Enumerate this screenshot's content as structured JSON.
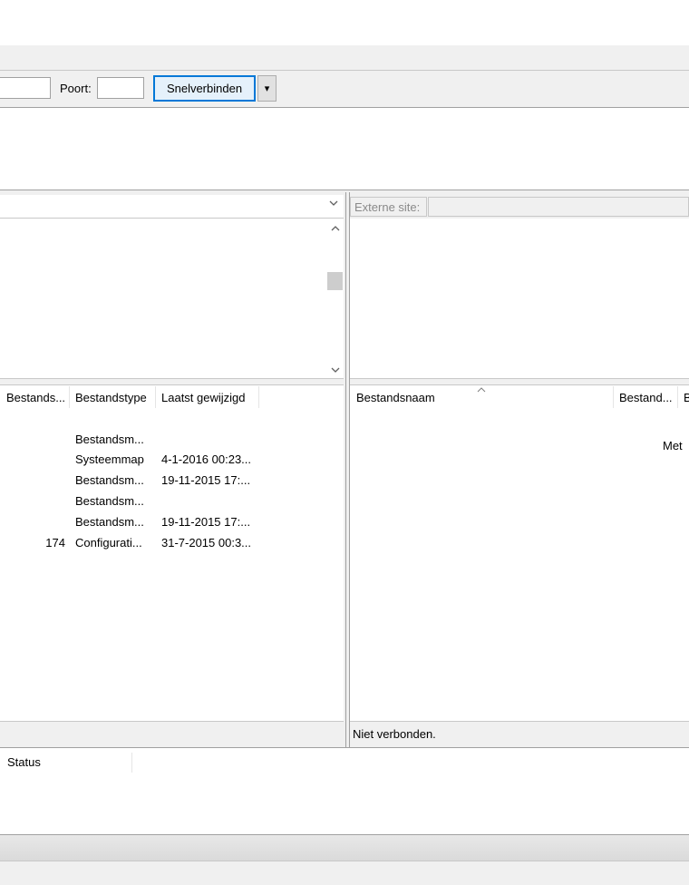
{
  "quickconnect": {
    "host_value": "",
    "port_label": "Poort:",
    "port_value": "",
    "connect_button": "Snelverbinden",
    "dropdown_arrow": "▾"
  },
  "local": {
    "path_value": "",
    "columns": [
      "Bestands...",
      "Bestandstype",
      "Laatst gewijzigd"
    ],
    "rows": [
      {
        "size": "",
        "type": "Bestandsm...",
        "modified": ""
      },
      {
        "size": "",
        "type": "Systeemmap",
        "modified": "4-1-2016 00:23..."
      },
      {
        "size": "",
        "type": "Bestandsm...",
        "modified": "19-11-2015 17:..."
      },
      {
        "size": "",
        "type": "Bestandsm...",
        "modified": ""
      },
      {
        "size": "",
        "type": "Bestandsm...",
        "modified": "19-11-2015 17:..."
      },
      {
        "size": "174",
        "type": "Configurati...",
        "modified": "31-7-2015 00:3..."
      }
    ],
    "status": ""
  },
  "remote": {
    "site_label": "Externe site:",
    "columns": [
      "Bestandsnaam",
      "Bestand...",
      "B"
    ],
    "empty_message": "Met",
    "status": "Niet verbonden."
  },
  "queue": {
    "columns": [
      "Status"
    ]
  },
  "colors": {
    "accent": "#0078d7",
    "border": "#a0a0a0",
    "panel_bg": "#ffffff",
    "chrome_bg": "#f0f0f0"
  }
}
